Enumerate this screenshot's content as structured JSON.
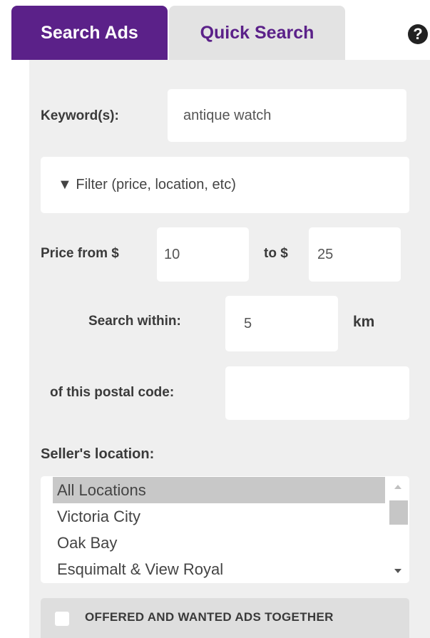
{
  "tabs": {
    "active": "Search Ads",
    "inactive": "Quick Search"
  },
  "help": {
    "glyph": "?"
  },
  "keyword": {
    "label": "Keyword(s):",
    "value": "antique watch"
  },
  "filter": {
    "label": "▼ Filter (price, location, etc)"
  },
  "price": {
    "from_label": "Price from $",
    "from_value": "10",
    "to_label": "to $",
    "to_value": "25"
  },
  "distance": {
    "label": "Search within:",
    "value": "5",
    "unit": "km"
  },
  "postal": {
    "label": "of this postal code:",
    "value": ""
  },
  "seller_location": {
    "label": "Seller's location:",
    "options": [
      "All Locations",
      "Victoria City",
      "Oak Bay",
      "Esquimalt & View Royal"
    ],
    "selected": "All Locations"
  },
  "offered_wanted": {
    "label": "OFFERED AND WANTED ADS TOGETHER",
    "checked": false
  },
  "colors": {
    "brand": "#5b2189",
    "panel": "#efefef",
    "inactive_tab": "#e3e3e3"
  }
}
